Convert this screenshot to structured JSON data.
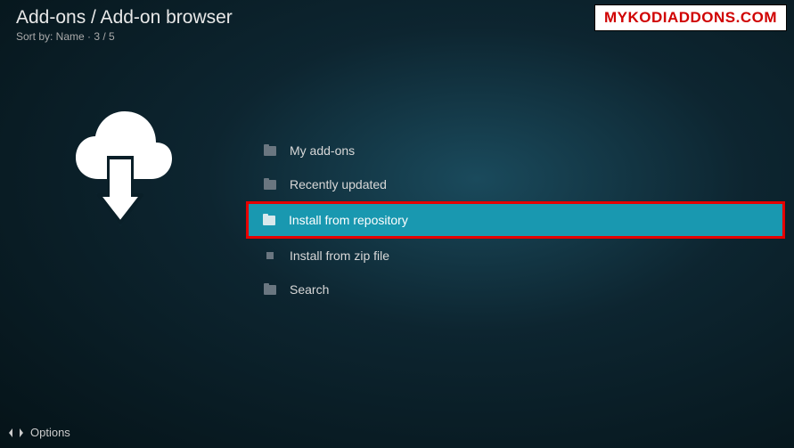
{
  "header": {
    "breadcrumb": "Add-ons / Add-on browser",
    "sortby": "Sort by: Name  ·  3 / 5"
  },
  "watermark": "MYKODIADDONS.COM",
  "items": [
    {
      "label": "My add-ons",
      "icon": "folder"
    },
    {
      "label": "Recently updated",
      "icon": "folder"
    },
    {
      "label": "Install from repository",
      "icon": "folder",
      "selected": true
    },
    {
      "label": "Install from zip file",
      "icon": "square"
    },
    {
      "label": "Search",
      "icon": "folder"
    }
  ],
  "footer": {
    "options": "Options"
  }
}
